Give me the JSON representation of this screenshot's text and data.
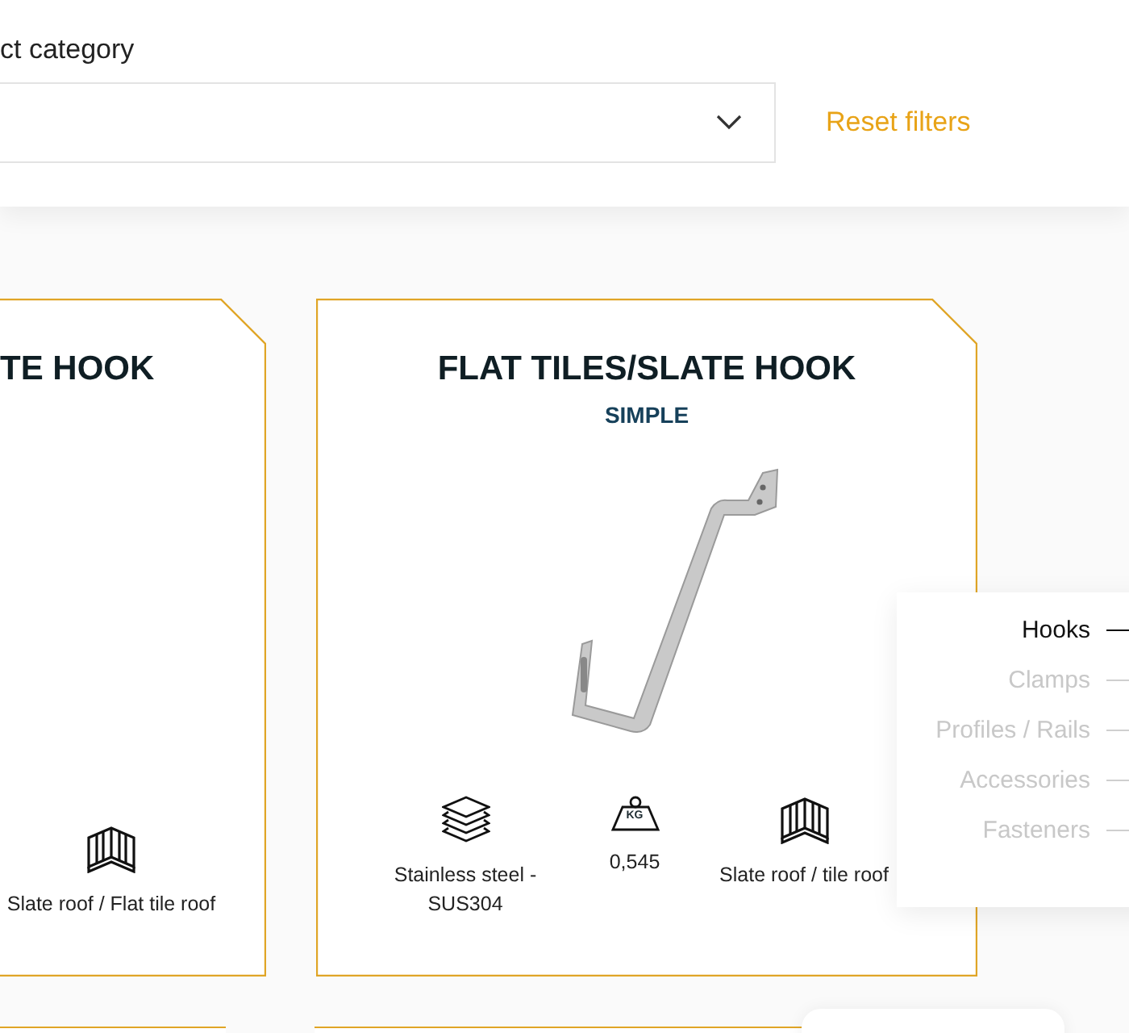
{
  "filter": {
    "label": "ct category",
    "reset_button": "Reset filters"
  },
  "cards": [
    {
      "title": "TE HOOK",
      "has_product_image": false,
      "specs": [
        {
          "kind": "roof",
          "text": "Slate roof / Flat tile roof"
        }
      ]
    },
    {
      "title": "FLAT TILES/SLATE HOOK",
      "subtitle": "SIMPLE",
      "has_product_image": true,
      "specs": [
        {
          "kind": "material",
          "text": "Stainless steel - SUS304"
        },
        {
          "kind": "weight",
          "icon_label": "KG",
          "text": "0,545"
        },
        {
          "kind": "roof",
          "text": "Slate roof / tile roof"
        }
      ]
    }
  ],
  "category_nav": [
    {
      "label": "Hooks",
      "selected": true
    },
    {
      "label": "Clamps",
      "selected": false
    },
    {
      "label": "Profiles / Rails",
      "selected": false
    },
    {
      "label": "Accessories",
      "selected": false
    },
    {
      "label": "Fasteners",
      "selected": false
    }
  ]
}
